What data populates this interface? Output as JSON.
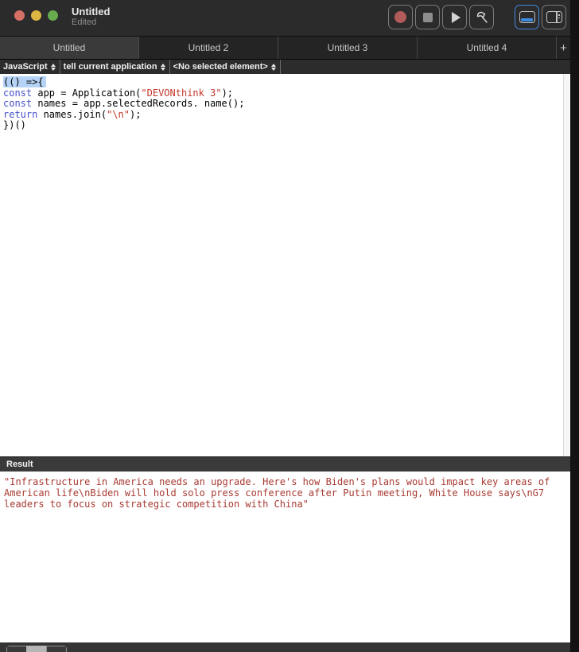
{
  "window": {
    "title": "Untitled",
    "subtitle": "Edited"
  },
  "toolbar": {
    "buttons": [
      {
        "name": "record"
      },
      {
        "name": "stop"
      },
      {
        "name": "run"
      },
      {
        "name": "compile"
      }
    ],
    "view_buttons": [
      {
        "name": "show-bottom-pane",
        "active": true
      },
      {
        "name": "show-accessory-view",
        "active": false
      }
    ]
  },
  "tabs": {
    "items": [
      {
        "label": "Untitled",
        "active": true
      },
      {
        "label": "Untitled 2",
        "active": false
      },
      {
        "label": "Untitled 3",
        "active": false
      },
      {
        "label": "Untitled 4",
        "active": false
      }
    ],
    "add_label": "+"
  },
  "navbar": {
    "popups": [
      {
        "label": "JavaScript"
      },
      {
        "label": "tell current application"
      },
      {
        "label": "<No selected element>"
      }
    ]
  },
  "code": {
    "lines": [
      {
        "selected": true,
        "tokens": [
          {
            "t": "(() =>{",
            "c": "plain"
          }
        ]
      },
      {
        "selected": false,
        "tokens": [
          {
            "t": "const",
            "c": "kw"
          },
          {
            "t": " app = Application(",
            "c": "plain"
          },
          {
            "t": "\"DEVONthink 3\"",
            "c": "str"
          },
          {
            "t": ");",
            "c": "plain"
          }
        ]
      },
      {
        "selected": false,
        "tokens": [
          {
            "t": "const",
            "c": "kw"
          },
          {
            "t": " names = app.selectedRecords. name();",
            "c": "plain"
          }
        ]
      },
      {
        "selected": false,
        "tokens": [
          {
            "t": "return",
            "c": "kw"
          },
          {
            "t": " names.join(",
            "c": "plain"
          },
          {
            "t": "\"\\n\"",
            "c": "str"
          },
          {
            "t": ");",
            "c": "plain"
          }
        ]
      },
      {
        "selected": false,
        "tokens": [
          {
            "t": "})()",
            "c": "plain"
          }
        ]
      }
    ]
  },
  "result": {
    "header": "Result",
    "text": "\"Infrastructure in America needs an upgrade. Here's how Biden's plans would impact key areas of American life\\nBiden will hold solo press conference after Putin meeting, White House says\\nG7 leaders to focus on strategic competition with China\""
  },
  "colors": {
    "keyword": "#4450c8",
    "string": "#c3362b",
    "result_text": "#a83a32",
    "selection": "#b5d3f6",
    "accent_blue": "#3f8ae0",
    "record_red": "#b25b5b"
  }
}
